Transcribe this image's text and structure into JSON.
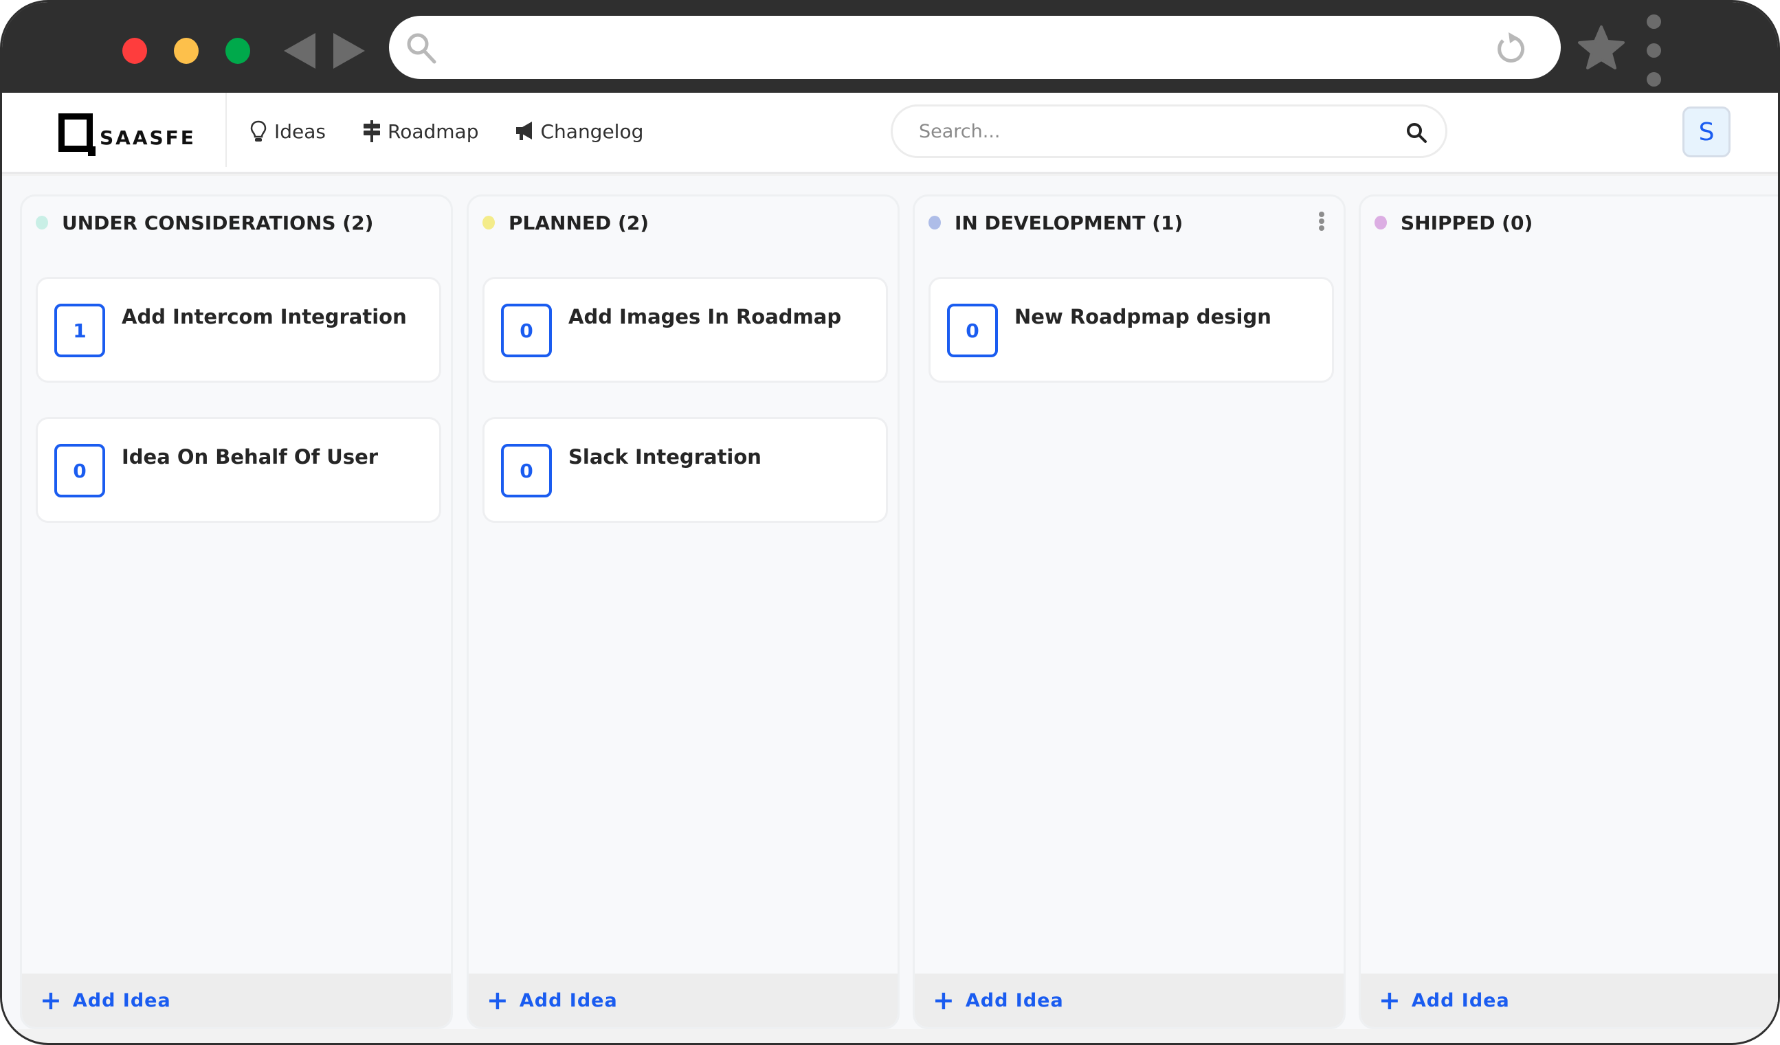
{
  "browser": {
    "address_value": "",
    "icons": {
      "back": "back-arrow-icon",
      "forward": "forward-arrow-icon",
      "search": "magnifier-icon",
      "reload": "reload-icon",
      "bookmark": "star-icon",
      "menu": "vertical-dots-icon"
    },
    "traffic_lights": [
      "#fe3d3d",
      "#fdc04b",
      "#00a94b"
    ]
  },
  "header": {
    "logo_text": "SAASFE",
    "nav": [
      {
        "label": "Ideas",
        "icon": "lightbulb-icon"
      },
      {
        "label": "Roadmap",
        "icon": "signpost-icon"
      },
      {
        "label": "Changelog",
        "icon": "megaphone-icon"
      }
    ],
    "search": {
      "placeholder": "Search...",
      "value": ""
    },
    "avatar_initial": "S"
  },
  "colors": {
    "accent": "#1a5cf0"
  },
  "board": {
    "columns": [
      {
        "title": "UNDER CONSIDERATIONS (2)",
        "dot_color": "#c9efe6",
        "has_menu": false,
        "cards": [
          {
            "votes": "1",
            "title": "Add Intercom Integration"
          },
          {
            "votes": "0",
            "title": "Idea On Behalf Of User"
          }
        ],
        "footer_label": "Add Idea"
      },
      {
        "title": "PLANNED (2)",
        "dot_color": "#f4ec8a",
        "has_menu": false,
        "cards": [
          {
            "votes": "0",
            "title": "Add Images In Roadmap"
          },
          {
            "votes": "0",
            "title": "Slack Integration"
          }
        ],
        "footer_label": "Add Idea"
      },
      {
        "title": "IN DEVELOPMENT (1)",
        "dot_color": "#aebde8",
        "has_menu": true,
        "cards": [
          {
            "votes": "0",
            "title": "New Roadpmap design"
          }
        ],
        "footer_label": "Add Idea"
      },
      {
        "title": "SHIPPED (0)",
        "dot_color": "#dcaee3",
        "has_menu": false,
        "cards": [],
        "footer_label": "Add Idea"
      }
    ]
  }
}
